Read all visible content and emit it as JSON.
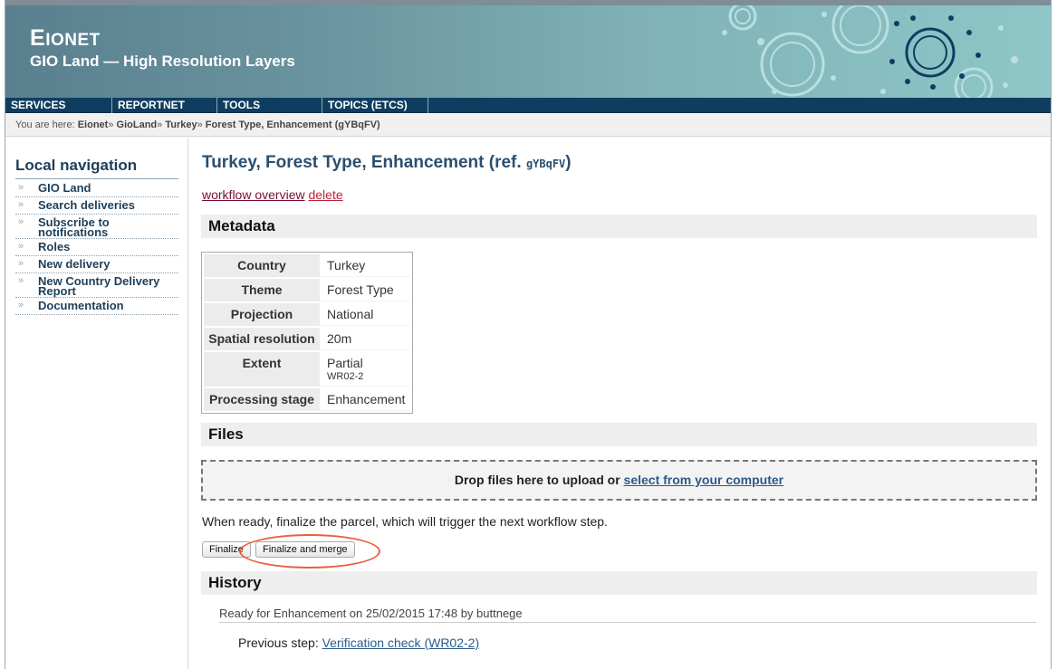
{
  "header": {
    "brand_first": "E",
    "brand_rest": "IONET",
    "subtitle": "GIO Land — High Resolution Layers"
  },
  "nav": {
    "items": [
      "SERVICES",
      "REPORTNET",
      "TOOLS",
      "TOPICS (ETCS)"
    ]
  },
  "breadcrumb": {
    "prefix": "You are here:",
    "items": [
      "Eionet",
      "GioLand",
      "Turkey",
      "Forest Type, Enhancement (gYBqFV)"
    ],
    "separator": "»"
  },
  "local_nav": {
    "title": "Local navigation",
    "bullet": "»",
    "items": [
      "GIO Land",
      "Search deliveries",
      "Subscribe to notifications",
      "Roles",
      "New delivery",
      "New Country Delivery Report",
      "Documentation"
    ]
  },
  "main": {
    "title": "Turkey, Forest Type, Enhancement (ref.",
    "ref": "gYBqFV",
    "title_close": ")",
    "actions": {
      "workflow_overview": "workflow overview",
      "delete": "delete"
    },
    "metadata_heading": "Metadata",
    "metadata": [
      {
        "key": "Country",
        "value": "Turkey",
        "sub": ""
      },
      {
        "key": "Theme",
        "value": "Forest Type",
        "sub": ""
      },
      {
        "key": "Projection",
        "value": "National",
        "sub": ""
      },
      {
        "key": "Spatial resolution",
        "value": "20m",
        "sub": ""
      },
      {
        "key": "Extent",
        "value": "Partial",
        "sub": "WR02-2"
      },
      {
        "key": "Processing stage",
        "value": "Enhancement",
        "sub": ""
      }
    ],
    "files_heading": "Files",
    "dropzone": {
      "text": "Drop files here to upload or",
      "link": "select from your computer"
    },
    "ready_text": "When ready, finalize the parcel, which will trigger the next workflow step.",
    "buttons": {
      "finalize": "Finalize",
      "finalize_merge": "Finalize and merge"
    },
    "history_heading": "History",
    "history_entry": "Ready for Enhancement on 25/02/2015 17:48 by buttnege",
    "previous_step_label": "Previous step:",
    "previous_step_link": "Verification check (WR02-2)"
  },
  "colors": {
    "nav_bg": "#0f3d5f",
    "annotation_circle": "#e8603a",
    "link": "#2a5a8a"
  }
}
